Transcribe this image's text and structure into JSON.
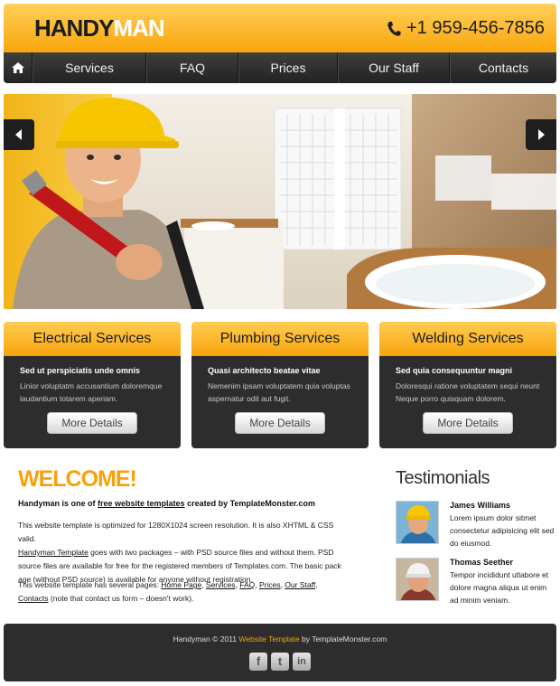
{
  "header": {
    "logo_part1": "HANDY",
    "logo_part2": "MAN",
    "phone": "+1 959-456-7856",
    "phone_icon": "phone-icon"
  },
  "nav": {
    "home_icon": "home-icon",
    "items": [
      "Services",
      "FAQ",
      "Prices",
      "Our Staff",
      "Contacts"
    ]
  },
  "slider": {
    "prev_icon": "arrow-left-icon",
    "next_icon": "arrow-right-icon"
  },
  "services": [
    {
      "title": "Electrical Services",
      "subtitle": "Sed ut perspiciatis unde omnis",
      "text": "Linior voluptatm accusantium doloremque laudantium totarem aperiam.",
      "button": "More Details"
    },
    {
      "title": "Plumbing Services",
      "subtitle": "Quasi architecto beatae vitae",
      "text": "Nemenim ipsam voluptatem quia voluptas aspernatur odit aut fugit.",
      "button": "More Details"
    },
    {
      "title": "Welding Services",
      "subtitle": "Sed quia consequuntur magni",
      "text": "Doloresqui ratione voluptatem sequi neunt Neque porro quisquam dolorem.",
      "button": "More Details"
    }
  ],
  "welcome": {
    "title": "WELCOME!",
    "lead_before": "Handyman is one of ",
    "lead_link": "free website templates",
    "lead_after": " created by TemplateMonster.com",
    "p1": "This website template is optimized for 1280X1024 screen resolution. It is also XHTML & CSS valid.",
    "p1_link": "Handyman Template",
    "p1_rest": " goes with two packages – with PSD source files and without them. PSD source files are available for free for the registered members of Templates.com. The basic pack age (without PSD source) is available for anyone without registration.",
    "p2_before": "This website template has several pages: ",
    "p2_links": [
      "Home Page",
      "Services",
      "FAQ",
      "Prices",
      "Our Staff",
      "Contacts"
    ],
    "p2_after": " (note that contact us form – doesn't work)."
  },
  "testimonials": {
    "title": "Testimonials",
    "items": [
      {
        "name": "James Williams",
        "text": "Lorem ipsum dolor sitmet consectetur adipisicing elit sed do eiusmod."
      },
      {
        "name": "Thomas Seether",
        "text": "Tempor incididunt utlabore et dolore magna aliqua ut enim ad minim veniam."
      }
    ]
  },
  "footer": {
    "text_before": "Handyman © 2011 ",
    "link": "Website Template",
    "text_after": " by TemplateMonster.com",
    "social": [
      {
        "icon": "facebook-icon",
        "glyph": "f"
      },
      {
        "icon": "twitter-icon",
        "glyph": "t"
      },
      {
        "icon": "linkedin-icon",
        "glyph": "in"
      }
    ]
  },
  "colors": {
    "accent": "#f7a10c",
    "dark": "#2d2d2d"
  }
}
